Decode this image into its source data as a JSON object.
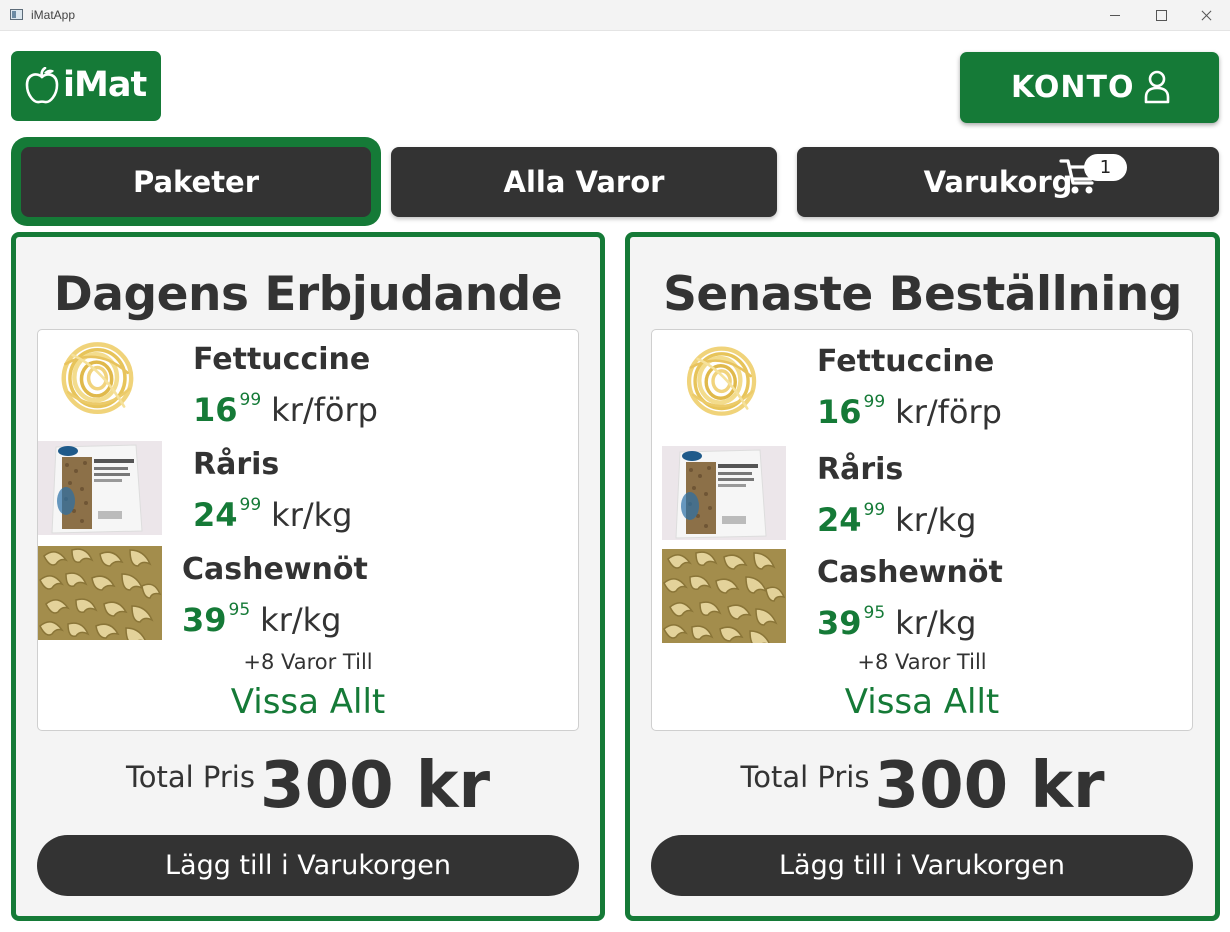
{
  "window": {
    "title": "iMatApp"
  },
  "header": {
    "logo_text": "iMat",
    "account_label": "KONTO"
  },
  "nav": {
    "tabs": [
      {
        "label": "Paketer",
        "active": true
      },
      {
        "label": "Alla Varor",
        "active": false
      },
      {
        "label": "Varukorg",
        "active": false
      }
    ],
    "cart_count": "1"
  },
  "colors": {
    "brand_green": "#157a37",
    "dark": "#333333",
    "panel_bg": "#f4f4f4"
  },
  "panels": [
    {
      "title": "Dagens Erbjudande",
      "items": [
        {
          "name": "Fettuccine",
          "price_int": "16",
          "price_dec": "99",
          "unit": "kr/förp"
        },
        {
          "name": "Råris",
          "price_int": "24",
          "price_dec": "99",
          "unit": "kr/kg"
        },
        {
          "name": "Cashewnöt",
          "price_int": "39",
          "price_dec": "95",
          "unit": "kr/kg"
        }
      ],
      "more_text": "+8 Varor Till",
      "show_all": "Vissa Allt",
      "total_label": "Total Pris",
      "total_amount": "300 kr",
      "add_button": "Lägg till i Varukorgen"
    },
    {
      "title": "Senaste Beställning",
      "items": [
        {
          "name": "Fettuccine",
          "price_int": "16",
          "price_dec": "99",
          "unit": "kr/förp"
        },
        {
          "name": "Råris",
          "price_int": "24",
          "price_dec": "99",
          "unit": "kr/kg"
        },
        {
          "name": "Cashewnöt",
          "price_int": "39",
          "price_dec": "95",
          "unit": "kr/kg"
        }
      ],
      "more_text": "+8 Varor Till",
      "show_all": "Vissa Allt",
      "total_label": "Total Pris",
      "total_amount": "300 kr",
      "add_button": "Lägg till i Varukorgen"
    }
  ]
}
